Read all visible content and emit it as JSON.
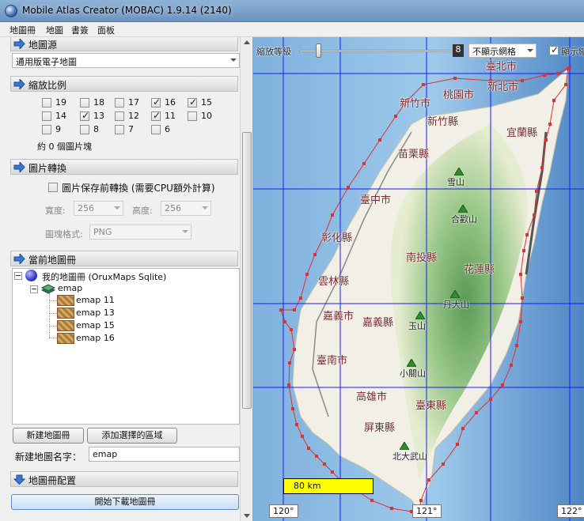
{
  "window": {
    "title": "Mobile Atlas Creator (MOBAC) 1.9.14 (2140)"
  },
  "menu": [
    "地圖冊",
    "地圖",
    "書簽",
    "面板"
  ],
  "sections": {
    "map_source": {
      "title": "地圖源",
      "selected": "通用版電子地圖"
    },
    "zoom_levels": {
      "title": "縮放比例",
      "levels": [
        {
          "label": "19",
          "checked": false
        },
        {
          "label": "18",
          "checked": false
        },
        {
          "label": "17",
          "checked": false
        },
        {
          "label": "16",
          "checked": true
        },
        {
          "label": "15",
          "checked": true
        },
        {
          "label": "14",
          "checked": false
        },
        {
          "label": "13",
          "checked": true
        },
        {
          "label": "12",
          "checked": false
        },
        {
          "label": "11",
          "checked": true
        },
        {
          "label": "10",
          "checked": false
        },
        {
          "label": "9",
          "checked": false
        },
        {
          "label": "8",
          "checked": false
        },
        {
          "label": "7",
          "checked": false
        },
        {
          "label": "6",
          "checked": false
        }
      ],
      "tile_count": "約 0 個圖片塊"
    },
    "image_conversion": {
      "title": "圖片轉換",
      "recompress_label": "圖片保存前轉換 (需要CPU額外計算)",
      "width_label": "寬度:",
      "width_value": "256",
      "height_label": "高度:",
      "height_value": "256",
      "format_label": "圖塊格式:",
      "format_value": "PNG"
    },
    "current_atlas": {
      "title": "當前地圖冊",
      "atlas_name": "我的地圖冊 (OruxMaps Sqlite)",
      "map_name": "emap",
      "layers": [
        "emap 11",
        "emap 13",
        "emap 15",
        "emap 16"
      ],
      "new_atlas_button": "新建地圖冊",
      "add_selection_button": "添加選擇的區域",
      "new_map_name_label": "新建地圖名字：",
      "new_map_name_value": "emap"
    },
    "atlas_settings": {
      "title": "地圖冊配置"
    },
    "start_download": "開始下載地圖冊"
  },
  "map": {
    "zoom_label": "縮放等級",
    "zoom_value": "8",
    "zoom_fraction": 0.35,
    "grid_select": "不顯示網格",
    "show_label": "顯示縮",
    "show_checked": true,
    "scale": "80 km",
    "longitudes": [
      "120°",
      "121°",
      "122°"
    ],
    "places": [
      {
        "name": "臺北市",
        "kind": "city"
      },
      {
        "name": "新北市",
        "kind": "city"
      },
      {
        "name": "桃園市",
        "kind": "city"
      },
      {
        "name": "新竹市",
        "kind": "city"
      },
      {
        "name": "新竹縣",
        "kind": "city"
      },
      {
        "name": "宜蘭縣",
        "kind": "city"
      },
      {
        "name": "苗栗縣",
        "kind": "city"
      },
      {
        "name": "雪山",
        "kind": "peak"
      },
      {
        "name": "臺中市",
        "kind": "city"
      },
      {
        "name": "合歡山",
        "kind": "peak"
      },
      {
        "name": "彰化縣",
        "kind": "city"
      },
      {
        "name": "南投縣",
        "kind": "city"
      },
      {
        "name": "花蓮縣",
        "kind": "city"
      },
      {
        "name": "雲林縣",
        "kind": "city"
      },
      {
        "name": "丹大山",
        "kind": "peak"
      },
      {
        "name": "嘉義市",
        "kind": "city"
      },
      {
        "name": "嘉義縣",
        "kind": "city"
      },
      {
        "name": "玉山",
        "kind": "peak"
      },
      {
        "name": "臺南市",
        "kind": "city"
      },
      {
        "name": "小關山",
        "kind": "peak"
      },
      {
        "name": "高雄市",
        "kind": "city"
      },
      {
        "name": "臺東縣",
        "kind": "city"
      },
      {
        "name": "屏東縣",
        "kind": "city"
      },
      {
        "name": "北大武山",
        "kind": "peak"
      }
    ],
    "colors": {
      "sea": "#5c8fc9",
      "grid": "#1a1aff",
      "selection": "#e03030",
      "scale_bar": "#ffff00"
    }
  }
}
